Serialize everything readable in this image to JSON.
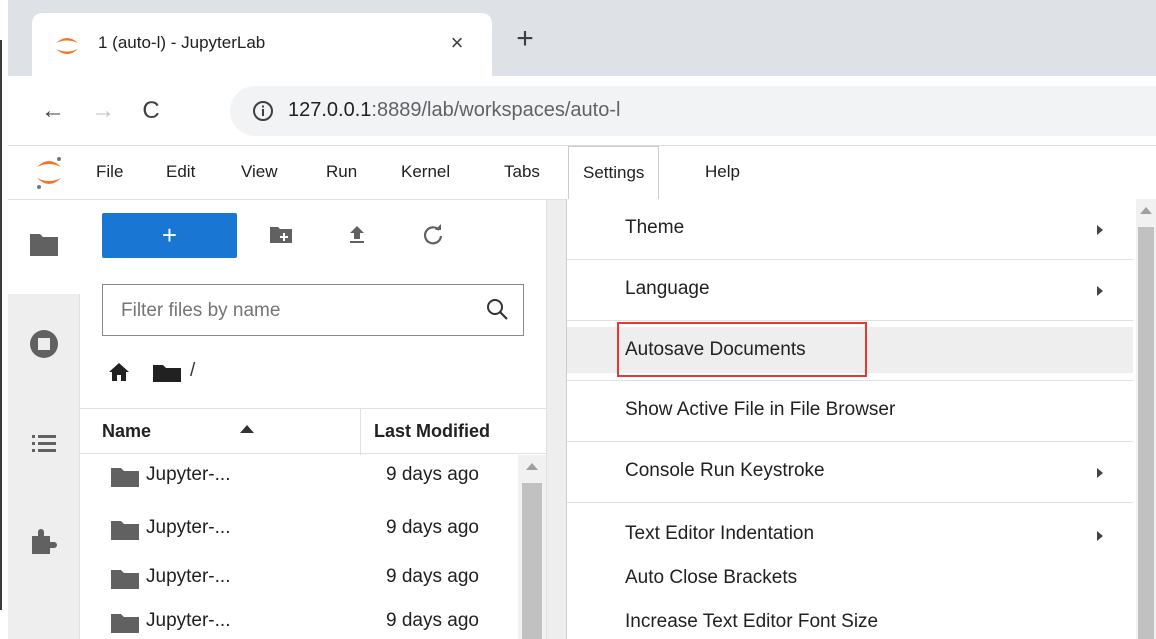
{
  "browser": {
    "tab_title": "1 (auto-l) - JupyterLab",
    "tab_close": "×",
    "new_tab": "+",
    "back": "←",
    "forward": "→",
    "reload": "C",
    "url_host": "127.0.0.1",
    "url_rest": ":8889/lab/workspaces/auto-l"
  },
  "menubar": {
    "items": [
      "File",
      "Edit",
      "View",
      "Run",
      "Kernel",
      "Tabs",
      "Settings",
      "Help"
    ],
    "active": "Settings"
  },
  "activity_bar": {
    "icons": [
      "folder-icon",
      "running-sessions-icon",
      "table-of-contents-icon",
      "extensions-icon"
    ]
  },
  "file_browser": {
    "launcher_label": "+",
    "filter_placeholder": "Filter files by name",
    "breadcrumb_path": "/",
    "columns": {
      "name": "Name",
      "modified": "Last Modified"
    },
    "files": [
      {
        "name": "Jupyter-...",
        "modified": "9 days ago"
      },
      {
        "name": "Jupyter-...",
        "modified": "9 days ago"
      },
      {
        "name": "Jupyter-...",
        "modified": "9 days ago"
      },
      {
        "name": "Jupyter-...",
        "modified": "9 days ago"
      }
    ]
  },
  "settings_menu": {
    "items": [
      {
        "label": "Theme",
        "submenu": true
      },
      {
        "label": "Language",
        "submenu": true
      },
      {
        "label": "Autosave Documents",
        "submenu": false,
        "hovered": true
      },
      {
        "label": "Show Active File in File Browser",
        "submenu": false
      },
      {
        "label": "Console Run Keystroke",
        "submenu": true
      },
      {
        "label": "Text Editor Indentation",
        "submenu": true
      },
      {
        "label": "Auto Close Brackets",
        "submenu": false
      },
      {
        "label": "Increase Text Editor Font Size",
        "submenu": false
      }
    ]
  },
  "colors": {
    "accent": "#1976d2",
    "highlight_box": "#e53935",
    "jupyter_orange": "#f37626"
  }
}
